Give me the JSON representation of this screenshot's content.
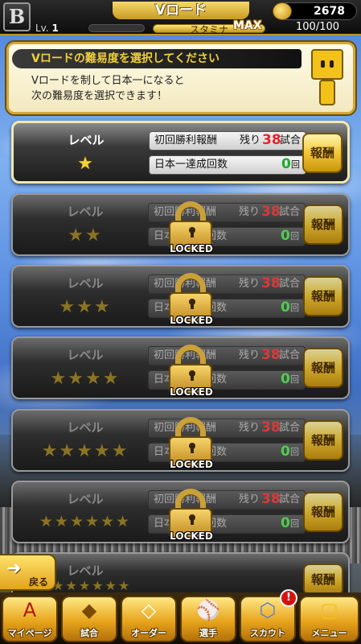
{
  "header": {
    "team_logo": "B",
    "title": "Vロード",
    "coins": "2678",
    "level_label": "Lv.",
    "level_value": "1",
    "stamina_label": "スタミナ",
    "stamina_max_label": "MAX",
    "stamina_value": "100/100"
  },
  "banner": {
    "heading": "Vロードの難易度を選択してください",
    "line1": "Vロードを制して日本一になると",
    "line2": "次の難易度を選択できます！"
  },
  "levels": [
    {
      "label": "レベル",
      "stars": "★",
      "reward_label": "初回勝利報酬",
      "remaining_label": "残り",
      "remaining": "38",
      "remaining_unit": "試合",
      "champ_label": "日本一達成回数",
      "champ_count": "0",
      "champ_unit": "回",
      "button": "報酬",
      "locked": false
    },
    {
      "label": "レベル",
      "stars": "★★",
      "reward_label": "初回勝利報酬",
      "remaining_label": "残り",
      "remaining": "38",
      "remaining_unit": "試合",
      "champ_label": "日本一達成回数",
      "champ_count": "0",
      "champ_unit": "回",
      "button": "報酬",
      "locked": true,
      "lock_text": "LOCKED"
    },
    {
      "label": "レベル",
      "stars": "★★★",
      "reward_label": "初回勝利報酬",
      "remaining_label": "残り",
      "remaining": "38",
      "remaining_unit": "試合",
      "champ_label": "日本一達成回数",
      "champ_count": "0",
      "champ_unit": "回",
      "button": "報酬",
      "locked": true,
      "lock_text": "LOCKED"
    },
    {
      "label": "レベル",
      "stars": "★★★★",
      "reward_label": "初回勝利報酬",
      "remaining_label": "残り",
      "remaining": "38",
      "remaining_unit": "試合",
      "champ_label": "日本一達成回数",
      "champ_count": "0",
      "champ_unit": "回",
      "button": "報酬",
      "locked": true,
      "lock_text": "LOCKED"
    },
    {
      "label": "レベル",
      "stars": "★★★★★",
      "reward_label": "初回勝利報酬",
      "remaining_label": "残り",
      "remaining": "38",
      "remaining_unit": "試合",
      "champ_label": "日本一達成回数",
      "champ_count": "0",
      "champ_unit": "回",
      "button": "報酬",
      "locked": true,
      "lock_text": "LOCKED"
    },
    {
      "label": "レベル",
      "stars": "★★★★★★",
      "reward_label": "初回勝利報酬",
      "remaining_label": "残り",
      "remaining": "38",
      "remaining_unit": "試合",
      "champ_label": "日本一達成回数",
      "champ_count": "0",
      "champ_unit": "回",
      "button": "報酬",
      "locked": true,
      "lock_text": "LOCKED"
    },
    {
      "label": "レベル",
      "stars": "★★★★★★★",
      "button": "報酬",
      "locked": true
    }
  ],
  "back_button": "戻る",
  "nav": [
    {
      "label": "マイページ",
      "icon": "A"
    },
    {
      "label": "試合",
      "icon": "◆"
    },
    {
      "label": "オーダー",
      "icon": "◇"
    },
    {
      "label": "選手",
      "icon": "⚾"
    },
    {
      "label": "スカウト",
      "icon": "⬡",
      "badge": "!"
    },
    {
      "label": "メニュー",
      "icon": "▢"
    }
  ],
  "colors": {
    "accent": "#f2c636",
    "remaining": "#e8232a",
    "count": "#1cab2a"
  }
}
